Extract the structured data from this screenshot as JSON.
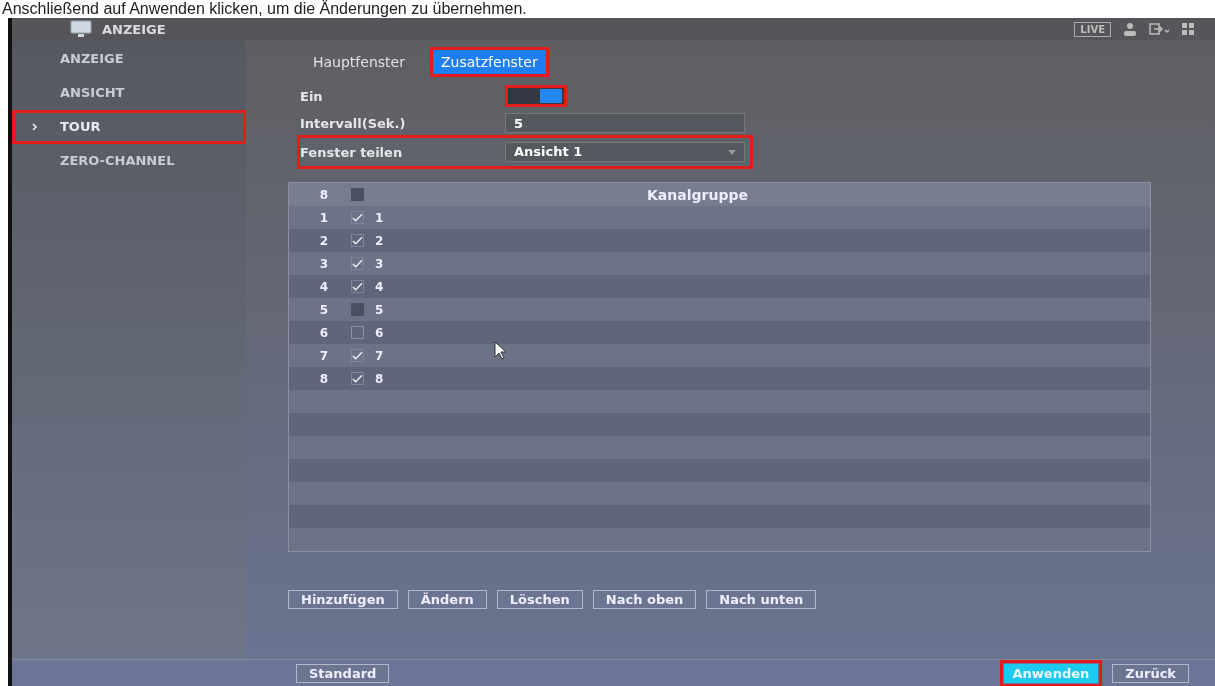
{
  "caption": "Anschließend auf Anwenden klicken, um die Änderungen zu übernehmen.",
  "header": {
    "title": "ANZEIGE",
    "live_button": "LIVE"
  },
  "sidebar": {
    "items": [
      {
        "label": "ANZEIGE",
        "selected": false,
        "highlighted": false
      },
      {
        "label": "ANSICHT",
        "selected": false,
        "highlighted": false
      },
      {
        "label": "TOUR",
        "selected": true,
        "highlighted": true
      },
      {
        "label": "ZERO-CHANNEL",
        "selected": false,
        "highlighted": false
      }
    ]
  },
  "tabs": [
    {
      "label": "Hauptfenster",
      "selected": false,
      "highlighted": false
    },
    {
      "label": "Zusatzfenster",
      "selected": true,
      "highlighted": true
    }
  ],
  "form": {
    "enable": {
      "label": "Ein",
      "on": true,
      "highlighted": true
    },
    "interval": {
      "label": "Intervall(Sek.)",
      "value": "5"
    },
    "split": {
      "label": "Fenster teilen",
      "value": "Ansicht 1",
      "highlighted": true
    }
  },
  "table": {
    "header": {
      "count": "8",
      "checked": false,
      "disabled": true,
      "title": "Kanalgruppe"
    },
    "rows": [
      {
        "number": "1",
        "checked": true,
        "disabled": false,
        "channels": "1"
      },
      {
        "number": "2",
        "checked": true,
        "disabled": false,
        "channels": "2"
      },
      {
        "number": "3",
        "checked": true,
        "disabled": false,
        "channels": "3"
      },
      {
        "number": "4",
        "checked": true,
        "disabled": false,
        "channels": "4"
      },
      {
        "number": "5",
        "checked": false,
        "disabled": true,
        "channels": "5"
      },
      {
        "number": "6",
        "checked": false,
        "disabled": false,
        "channels": "6"
      },
      {
        "number": "7",
        "checked": true,
        "disabled": false,
        "channels": "7"
      },
      {
        "number": "8",
        "checked": true,
        "disabled": false,
        "channels": "8"
      }
    ]
  },
  "actions": [
    "Hinzufügen",
    "Ändern",
    "Löschen",
    "Nach oben",
    "Nach unten"
  ],
  "footer": {
    "default_button": "Standard",
    "apply": {
      "label": "Anwenden",
      "highlighted": true
    },
    "back_button": "Zurück"
  }
}
